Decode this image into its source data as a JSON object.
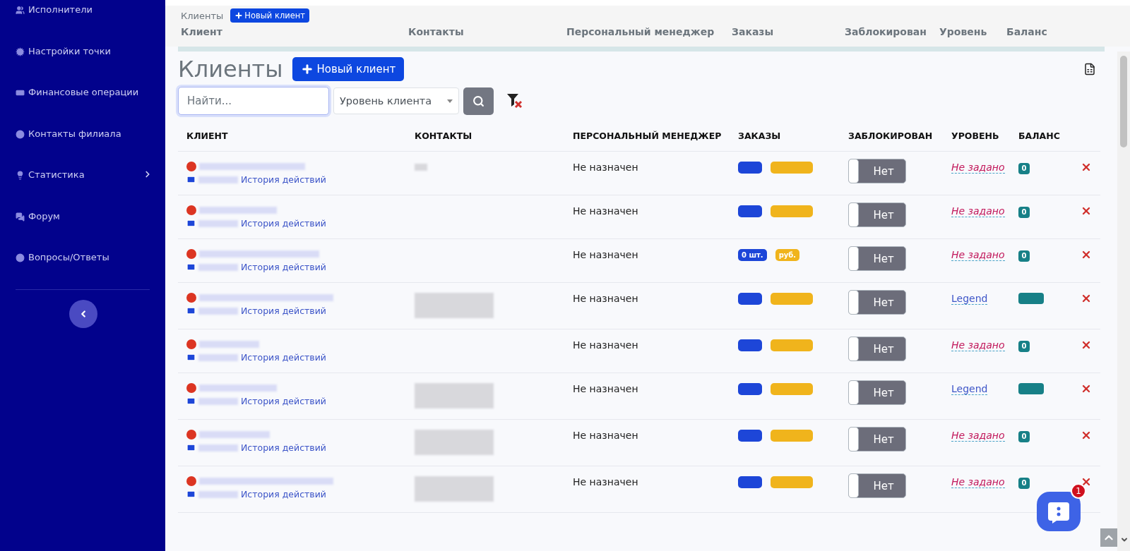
{
  "sidebar": {
    "items": [
      {
        "label": "Исполнители",
        "has_submenu": false
      },
      {
        "label": "Настройки точки",
        "has_submenu": false
      },
      {
        "label": "Финансовые операции",
        "has_submenu": false
      },
      {
        "label": "Контакты филиала",
        "has_submenu": false
      },
      {
        "label": "Статистика",
        "has_submenu": true
      },
      {
        "label": "Форум",
        "has_submenu": false
      },
      {
        "label": "Вопросы/Ответы",
        "has_submenu": false
      }
    ]
  },
  "sticky_header": {
    "title": "Клиенты",
    "new_button": "Новый клиент",
    "columns": [
      "Клиент",
      "Контакты",
      "Персональный менеджер",
      "Заказы",
      "Заблокирован",
      "Уровень",
      "Баланс"
    ]
  },
  "page": {
    "title": "Клиенты",
    "new_button": "Новый клиент"
  },
  "filters": {
    "search": {
      "placeholder": "Найти..."
    },
    "level_select": {
      "value": "Уровень клиента"
    }
  },
  "table": {
    "columns": [
      "КЛИЕНТ",
      "КОНТАКТЫ",
      "ПЕРСОНАЛЬНЫЙ МЕНЕДЖЕР",
      "ЗАКАЗЫ",
      "ЗАБЛОКИРОВАН",
      "УРОВЕНЬ",
      "БАЛАНС"
    ],
    "rows": [
      {
        "history_link": "История действий",
        "contacts_shown": true,
        "manager": "Не назначен",
        "blocked": {
          "on": false,
          "text": "Нет"
        },
        "level": {
          "kind": "unset",
          "text": "Не задано"
        },
        "balance": "0"
      },
      {
        "history_link": "История действий",
        "contacts_shown": false,
        "manager": "Не назначен",
        "blocked": {
          "on": false,
          "text": "Нет"
        },
        "level": {
          "kind": "unset",
          "text": "Не задано"
        },
        "balance": "0"
      },
      {
        "history_link": "История действий",
        "contacts_shown": false,
        "manager": "Не назначен",
        "orders_count": "0 шт.",
        "orders_sum": "руб.",
        "blocked": {
          "on": false,
          "text": "Нет"
        },
        "level": {
          "kind": "unset",
          "text": "Не задано"
        },
        "balance": "0"
      },
      {
        "history_link": "История действий",
        "contacts_shown": true,
        "manager": "Не назначен",
        "blocked": {
          "on": false,
          "text": "Нет"
        },
        "level": {
          "kind": "named",
          "text": "Legend"
        }
      },
      {
        "history_link": "История действий",
        "contacts_shown": false,
        "manager": "Не назначен",
        "blocked": {
          "on": false,
          "text": "Нет"
        },
        "level": {
          "kind": "unset",
          "text": "Не задано"
        },
        "balance": "0"
      },
      {
        "history_link": "История действий",
        "contacts_shown": true,
        "manager": "Не назначен",
        "blocked": {
          "on": false,
          "text": "Нет"
        },
        "level": {
          "kind": "named",
          "text": "Legend"
        }
      },
      {
        "history_link": "История действий",
        "contacts_shown": true,
        "manager": "Не назначен",
        "blocked": {
          "on": false,
          "text": "Нет"
        },
        "level": {
          "kind": "unset",
          "text": "Не задано"
        },
        "balance": "0"
      },
      {
        "history_link": "История действий",
        "contacts_shown": true,
        "manager": "Не назначен",
        "blocked": {
          "on": false,
          "text": "Нет"
        },
        "level": {
          "kind": "unset",
          "text": "Не задано"
        },
        "balance": "0"
      }
    ]
  },
  "chat_widget": {
    "badge": "1"
  }
}
